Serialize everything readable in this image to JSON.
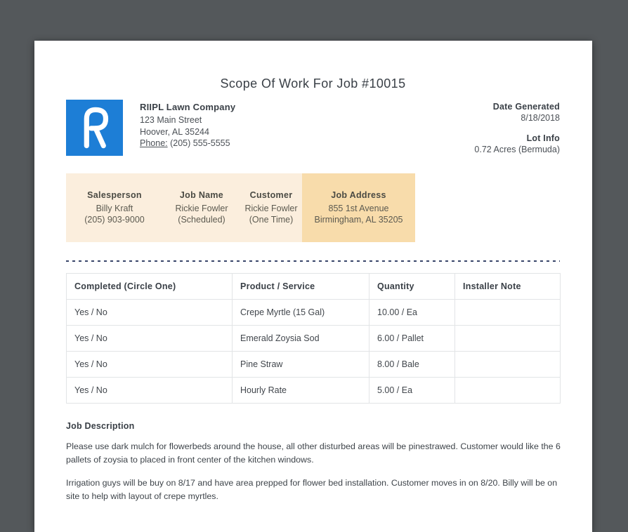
{
  "doc": {
    "title": "Scope Of Work For Job #10015"
  },
  "company": {
    "name": "RIIPL Lawn Company",
    "address_line1": "123 Main Street",
    "address_line2": "Hoover, AL 35244",
    "phone_label": "Phone:",
    "phone_number": "(205) 555-5555"
  },
  "meta": {
    "date_generated_label": "Date Generated",
    "date_generated": "8/18/2018",
    "lot_info_label": "Lot Info",
    "lot_info": "0.72 Acres (Bermuda)"
  },
  "job_info": {
    "columns": [
      {
        "label": "Salesperson",
        "line1": "Billy Kraft",
        "line2": "(205) 903-9000"
      },
      {
        "label": "Job Name",
        "line1": "Rickie Fowler",
        "line2": "(Scheduled)"
      },
      {
        "label": "Customer",
        "line1": "Rickie Fowler",
        "line2": "(One Time)"
      },
      {
        "label": "Job Address",
        "line1": "855 1st Avenue",
        "line2": "Birmingham, AL 35205"
      }
    ]
  },
  "work_table": {
    "headers": [
      "Completed (Circle One)",
      "Product / Service",
      "Quantity",
      "Installer Note"
    ],
    "rows": [
      [
        "Yes / No",
        "Crepe Myrtle (15 Gal)",
        "10.00 / Ea",
        ""
      ],
      [
        "Yes / No",
        "Emerald Zoysia Sod",
        "6.00 / Pallet",
        ""
      ],
      [
        "Yes / No",
        "Pine Straw",
        "8.00 / Bale",
        ""
      ],
      [
        "Yes / No",
        "Hourly Rate",
        "5.00 / Ea",
        ""
      ]
    ]
  },
  "job_description": {
    "heading": "Job Description",
    "paragraphs": [
      "Please use dark mulch for flowerbeds around the house, all other disturbed areas will be pinestrawed. Customer would like the 6 pallets of zoysia to placed in front center of the kitchen windows.",
      "Irrigation guys will be buy on 8/17 and have area prepped for flower bed installation. Customer moves in on 8/20. Billy will be on site to help with layout of crepe myrtles."
    ]
  },
  "colors": {
    "canvas_background": "#54585b",
    "logo_blue": "#1d7ed6",
    "info_bar_light": "#fbeedd",
    "info_bar_highlight": "#f8dcab",
    "dotted_divider": "#39466a",
    "table_border": "#e2e4e6"
  }
}
